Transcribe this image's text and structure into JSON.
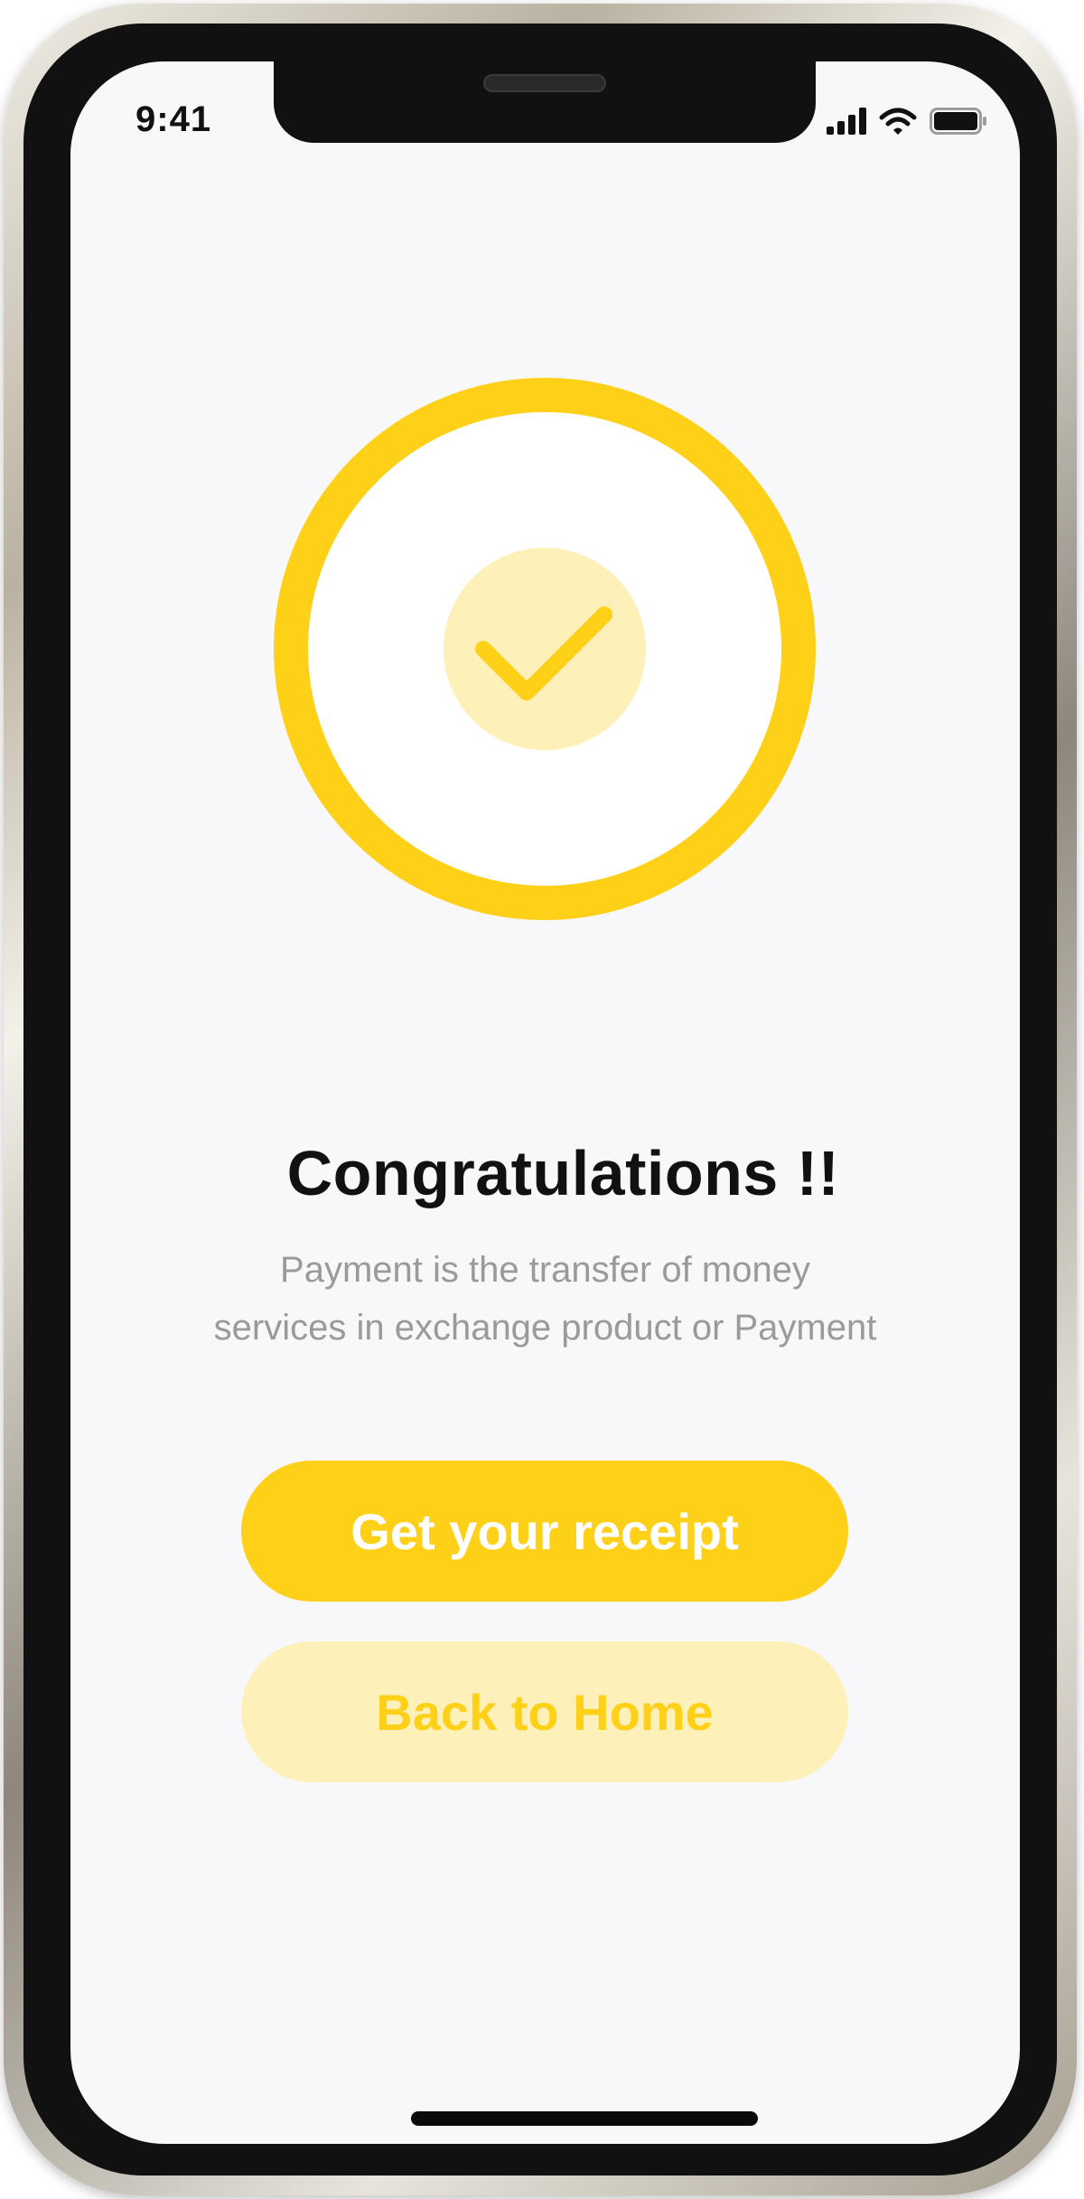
{
  "status_bar": {
    "time": "9:41",
    "icons": [
      "cellular-signal-icon",
      "wifi-icon",
      "battery-icon"
    ]
  },
  "success": {
    "icon": "checkmark-icon",
    "ring_color": "#fed118",
    "badge_color": "#fdf0b8"
  },
  "content": {
    "title": "Congratulations !!",
    "description_line1": "Payment is the transfer of money",
    "description_line2": "services in exchange product or Payment"
  },
  "actions": {
    "primary_label": "Get your receipt",
    "secondary_label": "Back to Home"
  },
  "colors": {
    "accent": "#fed118",
    "accent_light": "#fdf0b8",
    "background": "#f8f8fa",
    "title_text": "#111111",
    "muted_text": "#9a9a9a"
  }
}
